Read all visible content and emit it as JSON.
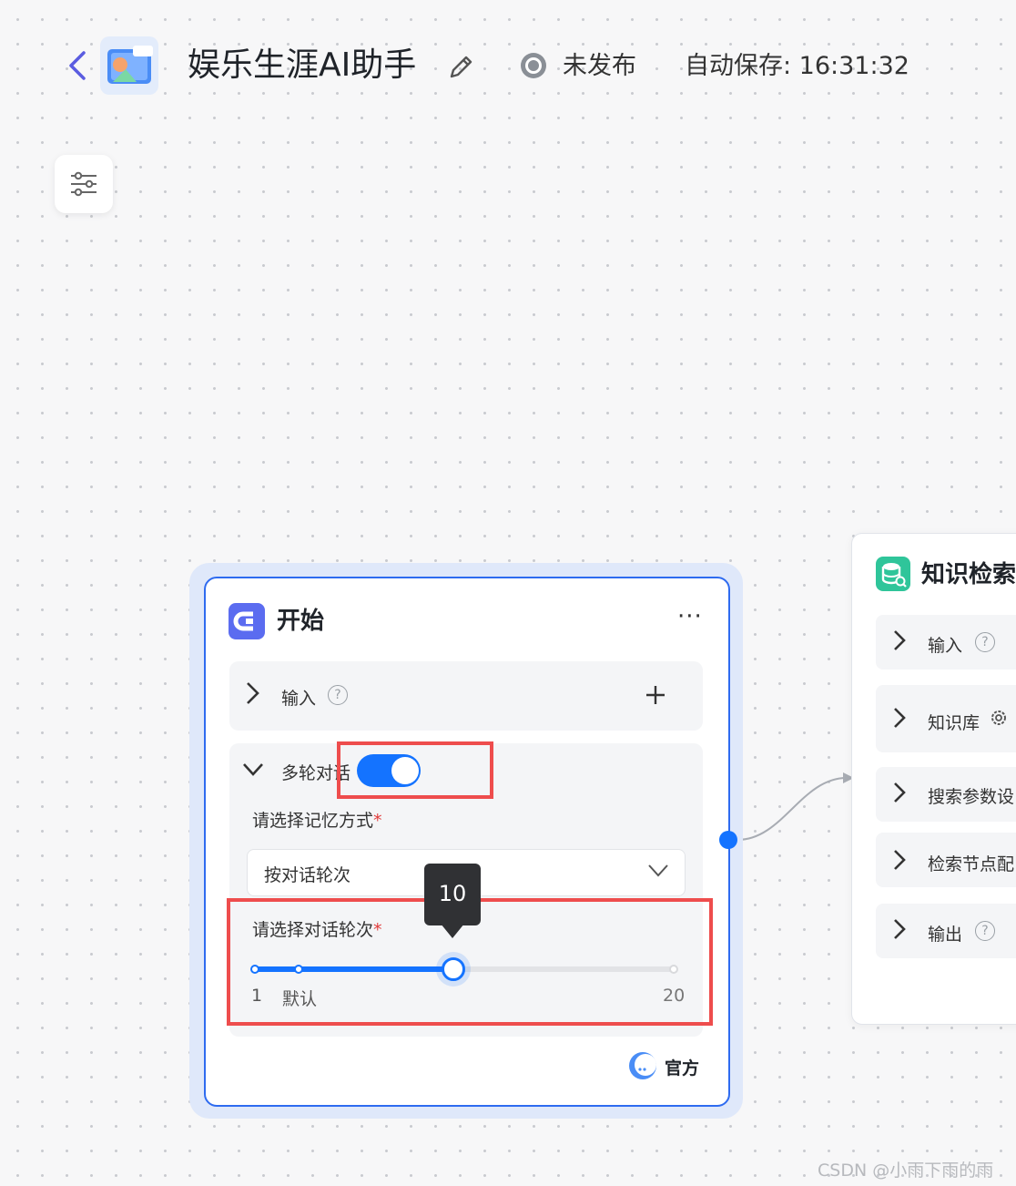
{
  "header": {
    "title": "娱乐生涯AI助手",
    "status": "未发布",
    "autosave": "自动保存: 16:31:32"
  },
  "start_node": {
    "title": "开始",
    "more": "···",
    "input_label": "输入",
    "multi_turn_label": "多轮对话",
    "multi_turn_enabled": true,
    "memory_mode_label": "请选择记忆方式",
    "memory_mode_value": "按对话轮次",
    "turns_label": "请选择对话轮次",
    "required_mark": "*",
    "turns": {
      "value": 10,
      "min": 1,
      "max": 20,
      "min_label": "1",
      "max_label": "20",
      "default_label": "默认",
      "tooltip": "10"
    },
    "footer_label": "官方"
  },
  "kb_node": {
    "title": "知识检索",
    "rows": [
      "输入",
      "知识库",
      "搜索参数设",
      "检索节点配",
      "输出"
    ]
  },
  "watermark": "CSDN @小雨下雨的雨",
  "colors": {
    "accent": "#1473ff",
    "highlight": "#ee4d4d",
    "node_border": "#2e6bf0",
    "kb_icon": "#2fc59a"
  }
}
